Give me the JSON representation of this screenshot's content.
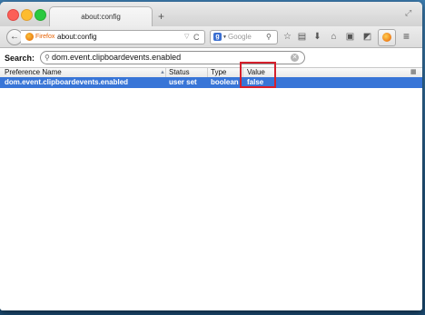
{
  "window": {
    "tab_title": "about:config",
    "new_tab_symbol": "+"
  },
  "navbar": {
    "back_symbol": "←",
    "identity_label": "Firefox",
    "url": "about:config",
    "url_dropdown_symbol": "▽",
    "reload_symbol": "C",
    "search_engine_initial": "g",
    "search_placeholder": "Google",
    "toolbar_icons": [
      {
        "name": "bookmark-star-icon",
        "symbol": "☆"
      },
      {
        "name": "reading-list-icon",
        "symbol": "▤"
      },
      {
        "name": "downloads-icon",
        "symbol": "⬇"
      },
      {
        "name": "home-icon",
        "symbol": "⌂"
      },
      {
        "name": "screenshot-icon",
        "symbol": "▣"
      },
      {
        "name": "pocket-icon",
        "symbol": "◩"
      }
    ],
    "menu_symbol": "≡"
  },
  "config": {
    "search_label": "Search:",
    "filter_value": "dom.event.clipboardevents.enabled",
    "columns": [
      "Preference Name",
      "Status",
      "Type",
      "Value"
    ],
    "rows": [
      {
        "name": "dom.event.clipboardevents.enabled",
        "status": "user set",
        "type": "boolean",
        "value": "false",
        "selected": true
      }
    ]
  },
  "colors": {
    "selection": "#3875d7",
    "highlight_box": "#d51f2c",
    "desktop": "#2a5d86"
  }
}
